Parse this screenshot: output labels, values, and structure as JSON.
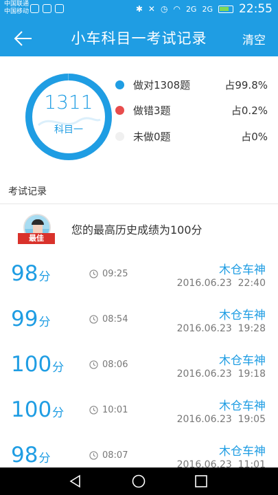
{
  "status_bar": {
    "carrier_1": "中国联通",
    "carrier_2": "中国移动",
    "network_1": "2G",
    "network_2": "2G",
    "time": "22:55",
    "icons": [
      "wechat-icon",
      "wechat-icon",
      "image-icon",
      "bluetooth-icon",
      "mute-icon",
      "alarm-icon",
      "wifi-icon",
      "signal-icon",
      "battery-icon"
    ]
  },
  "header": {
    "title": "小车科目一考试记录",
    "clear_label": "清空",
    "back_icon": "back-arrow-icon"
  },
  "summary": {
    "total": "1311",
    "subject": "科目一",
    "correct_fraction": 0.998,
    "legend": [
      {
        "label": "做对1308题",
        "percent": "占99.8%",
        "color": "#1f9de3"
      },
      {
        "label": "做错3题",
        "percent": "占0.2%",
        "color": "#e84c4c"
      },
      {
        "label": "未做0题",
        "percent": "占0%",
        "color": "#f0f0f0"
      }
    ]
  },
  "records_section": {
    "title": "考试记录",
    "best_badge": "最佳",
    "best_text": "您的最高历史成绩为100分"
  },
  "records": [
    {
      "score": "98",
      "unit": "分",
      "duration": "09:25",
      "user": "木仓车神",
      "date": "2016.06.23  22:40"
    },
    {
      "score": "99",
      "unit": "分",
      "duration": "08:54",
      "user": "木仓车神",
      "date": "2016.06.23  19:28"
    },
    {
      "score": "100",
      "unit": "分",
      "duration": "08:06",
      "user": "木仓车神",
      "date": "2016.06.23  19:18"
    },
    {
      "score": "100",
      "unit": "分",
      "duration": "10:01",
      "user": "木仓车神",
      "date": "2016.06.23  19:05"
    },
    {
      "score": "98",
      "unit": "分",
      "duration": "08:07",
      "user": "木仓车神",
      "date": "2016.06.23  11:01"
    }
  ],
  "colors": {
    "primary": "#1f9de3",
    "wrong": "#e84c4c",
    "badge": "#d9322b"
  }
}
